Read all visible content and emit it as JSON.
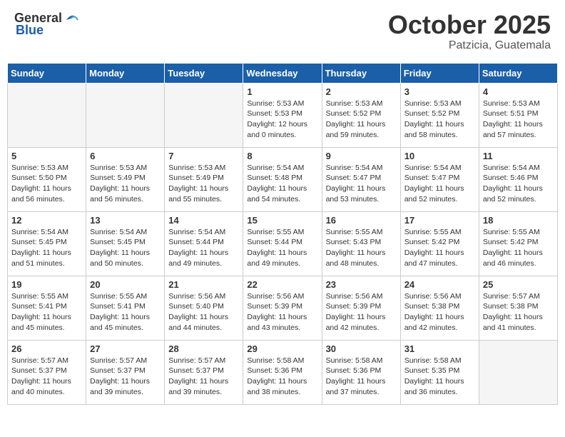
{
  "header": {
    "logo_general": "General",
    "logo_blue": "Blue",
    "month": "October 2025",
    "location": "Patzicia, Guatemala"
  },
  "weekdays": [
    "Sunday",
    "Monday",
    "Tuesday",
    "Wednesday",
    "Thursday",
    "Friday",
    "Saturday"
  ],
  "weeks": [
    [
      {
        "day": "",
        "info": ""
      },
      {
        "day": "",
        "info": ""
      },
      {
        "day": "",
        "info": ""
      },
      {
        "day": "1",
        "info": "Sunrise: 5:53 AM\nSunset: 5:53 PM\nDaylight: 12 hours and 0 minutes."
      },
      {
        "day": "2",
        "info": "Sunrise: 5:53 AM\nSunset: 5:52 PM\nDaylight: 11 hours and 59 minutes."
      },
      {
        "day": "3",
        "info": "Sunrise: 5:53 AM\nSunset: 5:52 PM\nDaylight: 11 hours and 58 minutes."
      },
      {
        "day": "4",
        "info": "Sunrise: 5:53 AM\nSunset: 5:51 PM\nDaylight: 11 hours and 57 minutes."
      }
    ],
    [
      {
        "day": "5",
        "info": "Sunrise: 5:53 AM\nSunset: 5:50 PM\nDaylight: 11 hours and 56 minutes."
      },
      {
        "day": "6",
        "info": "Sunrise: 5:53 AM\nSunset: 5:49 PM\nDaylight: 11 hours and 56 minutes."
      },
      {
        "day": "7",
        "info": "Sunrise: 5:53 AM\nSunset: 5:49 PM\nDaylight: 11 hours and 55 minutes."
      },
      {
        "day": "8",
        "info": "Sunrise: 5:54 AM\nSunset: 5:48 PM\nDaylight: 11 hours and 54 minutes."
      },
      {
        "day": "9",
        "info": "Sunrise: 5:54 AM\nSunset: 5:47 PM\nDaylight: 11 hours and 53 minutes."
      },
      {
        "day": "10",
        "info": "Sunrise: 5:54 AM\nSunset: 5:47 PM\nDaylight: 11 hours and 52 minutes."
      },
      {
        "day": "11",
        "info": "Sunrise: 5:54 AM\nSunset: 5:46 PM\nDaylight: 11 hours and 52 minutes."
      }
    ],
    [
      {
        "day": "12",
        "info": "Sunrise: 5:54 AM\nSunset: 5:45 PM\nDaylight: 11 hours and 51 minutes."
      },
      {
        "day": "13",
        "info": "Sunrise: 5:54 AM\nSunset: 5:45 PM\nDaylight: 11 hours and 50 minutes."
      },
      {
        "day": "14",
        "info": "Sunrise: 5:54 AM\nSunset: 5:44 PM\nDaylight: 11 hours and 49 minutes."
      },
      {
        "day": "15",
        "info": "Sunrise: 5:55 AM\nSunset: 5:44 PM\nDaylight: 11 hours and 49 minutes."
      },
      {
        "day": "16",
        "info": "Sunrise: 5:55 AM\nSunset: 5:43 PM\nDaylight: 11 hours and 48 minutes."
      },
      {
        "day": "17",
        "info": "Sunrise: 5:55 AM\nSunset: 5:42 PM\nDaylight: 11 hours and 47 minutes."
      },
      {
        "day": "18",
        "info": "Sunrise: 5:55 AM\nSunset: 5:42 PM\nDaylight: 11 hours and 46 minutes."
      }
    ],
    [
      {
        "day": "19",
        "info": "Sunrise: 5:55 AM\nSunset: 5:41 PM\nDaylight: 11 hours and 45 minutes."
      },
      {
        "day": "20",
        "info": "Sunrise: 5:55 AM\nSunset: 5:41 PM\nDaylight: 11 hours and 45 minutes."
      },
      {
        "day": "21",
        "info": "Sunrise: 5:56 AM\nSunset: 5:40 PM\nDaylight: 11 hours and 44 minutes."
      },
      {
        "day": "22",
        "info": "Sunrise: 5:56 AM\nSunset: 5:39 PM\nDaylight: 11 hours and 43 minutes."
      },
      {
        "day": "23",
        "info": "Sunrise: 5:56 AM\nSunset: 5:39 PM\nDaylight: 11 hours and 42 minutes."
      },
      {
        "day": "24",
        "info": "Sunrise: 5:56 AM\nSunset: 5:38 PM\nDaylight: 11 hours and 42 minutes."
      },
      {
        "day": "25",
        "info": "Sunrise: 5:57 AM\nSunset: 5:38 PM\nDaylight: 11 hours and 41 minutes."
      }
    ],
    [
      {
        "day": "26",
        "info": "Sunrise: 5:57 AM\nSunset: 5:37 PM\nDaylight: 11 hours and 40 minutes."
      },
      {
        "day": "27",
        "info": "Sunrise: 5:57 AM\nSunset: 5:37 PM\nDaylight: 11 hours and 39 minutes."
      },
      {
        "day": "28",
        "info": "Sunrise: 5:57 AM\nSunset: 5:37 PM\nDaylight: 11 hours and 39 minutes."
      },
      {
        "day": "29",
        "info": "Sunrise: 5:58 AM\nSunset: 5:36 PM\nDaylight: 11 hours and 38 minutes."
      },
      {
        "day": "30",
        "info": "Sunrise: 5:58 AM\nSunset: 5:36 PM\nDaylight: 11 hours and 37 minutes."
      },
      {
        "day": "31",
        "info": "Sunrise: 5:58 AM\nSunset: 5:35 PM\nDaylight: 11 hours and 36 minutes."
      },
      {
        "day": "",
        "info": ""
      }
    ]
  ]
}
